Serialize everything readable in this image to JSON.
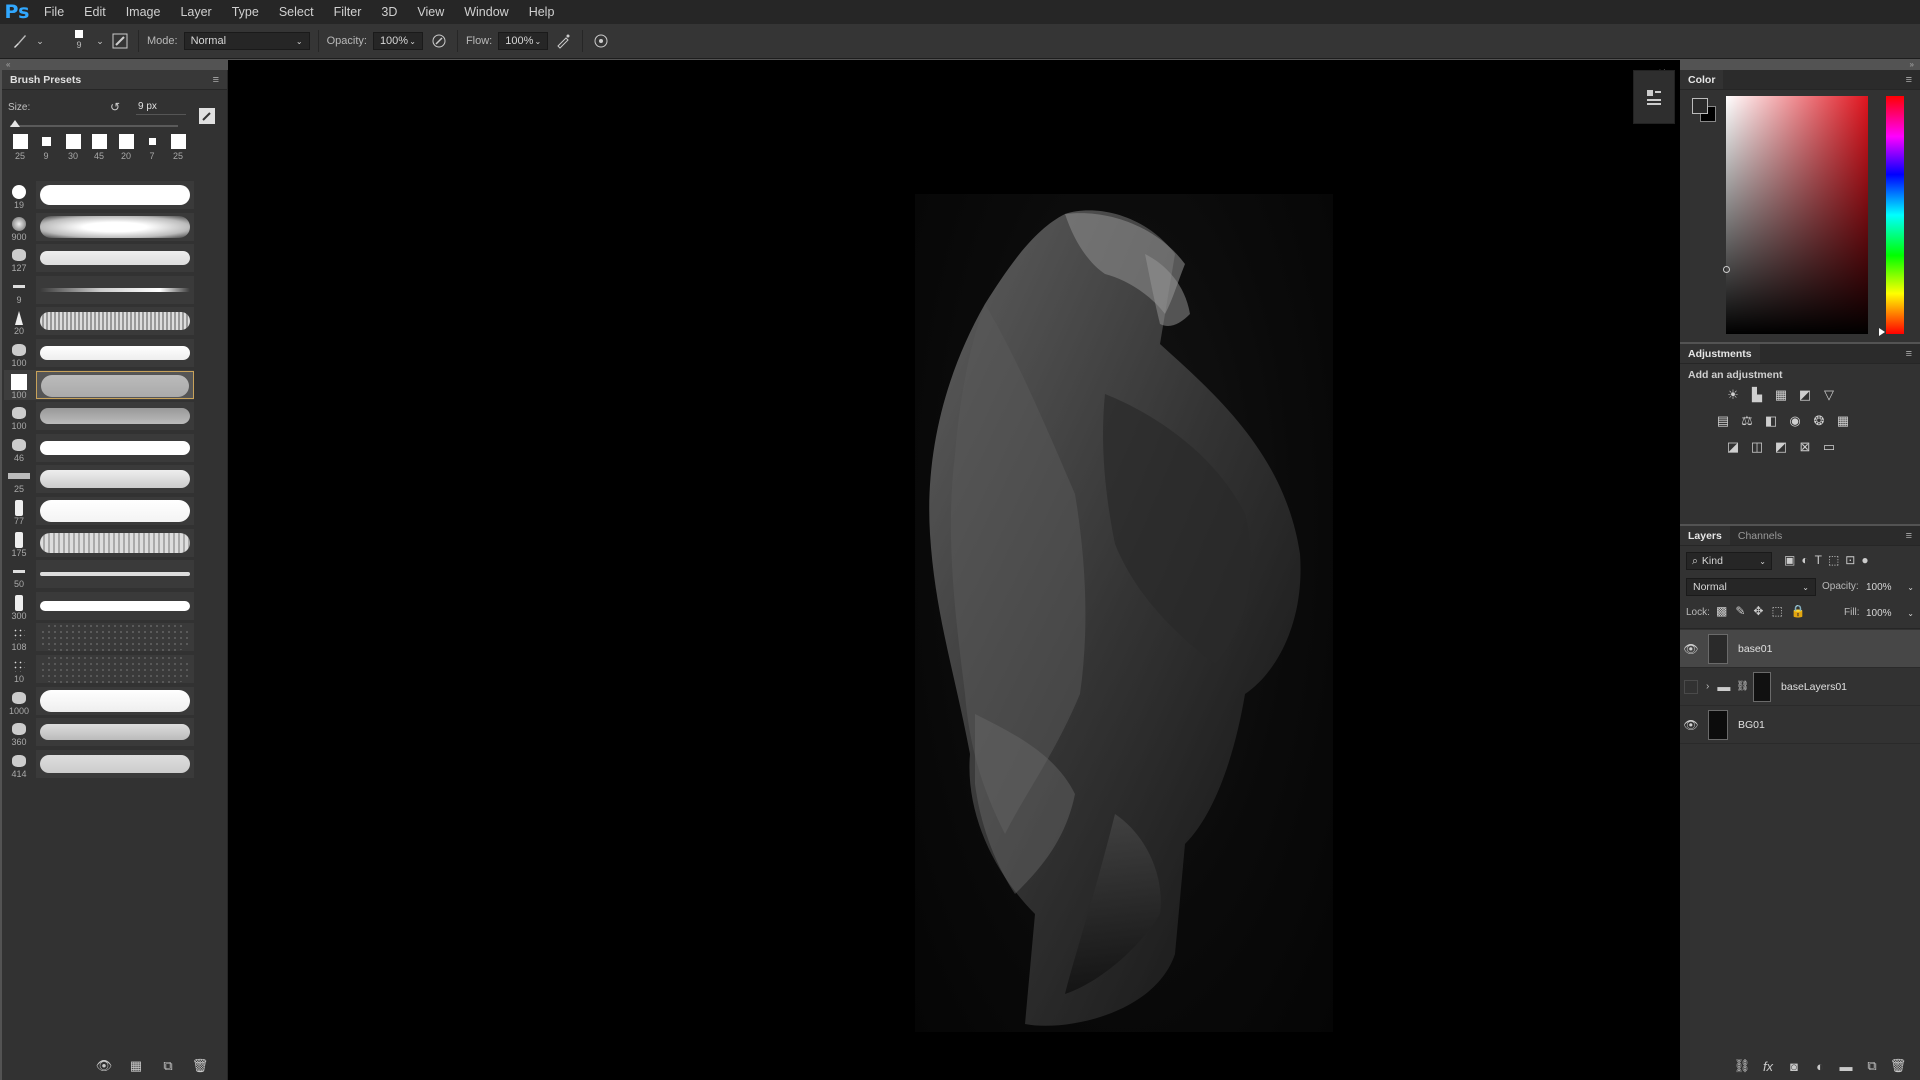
{
  "app": {
    "logo": "Ps"
  },
  "menu": [
    "File",
    "Edit",
    "Image",
    "Layer",
    "Type",
    "Select",
    "Filter",
    "3D",
    "View",
    "Window",
    "Help"
  ],
  "options": {
    "brush_size": "9",
    "mode_label": "Mode:",
    "mode_value": "Normal",
    "opacity_label": "Opacity:",
    "opacity_value": "100%",
    "flow_label": "Flow:",
    "flow_value": "100%"
  },
  "brush_panel": {
    "title": "Brush Presets",
    "size_label": "Size:",
    "size_value": "9 px",
    "recent_sizes": [
      "25",
      "9",
      "30",
      "45",
      "20",
      "7",
      "25"
    ],
    "brushes": [
      "19",
      "900",
      "127",
      "9",
      "20",
      "100",
      "100",
      "100",
      "46",
      "25",
      "77",
      "175",
      "50",
      "300",
      "108",
      "10",
      "1000",
      "360",
      "414"
    ],
    "selected_index": 6
  },
  "color_panel": {
    "title": "Color"
  },
  "adjustments": {
    "title": "Adjustments",
    "subtitle": "Add an adjustment"
  },
  "layers": {
    "tabs": [
      "Layers",
      "Channels"
    ],
    "filter_kind": "Kind",
    "blend_mode": "Normal",
    "opacity_label": "Opacity:",
    "opacity_value": "100%",
    "lock_label": "Lock:",
    "fill_label": "Fill:",
    "fill_value": "100%",
    "items": [
      {
        "name": "base01",
        "visible": true,
        "selected": true
      },
      {
        "name": "baseLayers01",
        "visible": false,
        "selected": false,
        "group": true
      },
      {
        "name": "BG01",
        "visible": true,
        "selected": false
      }
    ]
  },
  "colors": {
    "accent": "#31a8ff",
    "selected_brush_border": "#c8a25a"
  }
}
